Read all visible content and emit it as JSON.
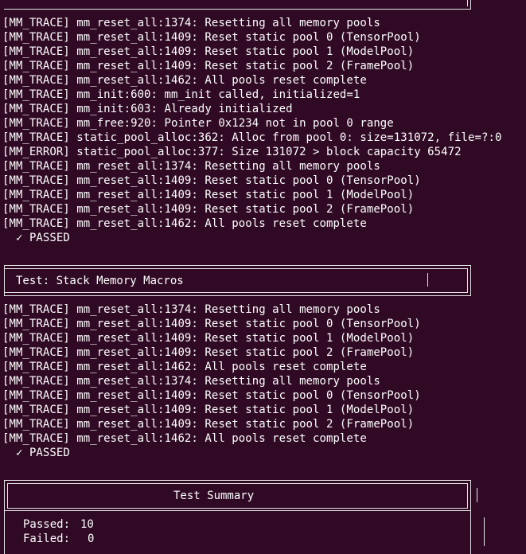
{
  "log_block_1": [
    "[MM_TRACE] mm_reset_all:1374: Resetting all memory pools",
    "[MM_TRACE] mm_reset_all:1409: Reset static pool 0 (TensorPool)",
    "[MM_TRACE] mm_reset_all:1409: Reset static pool 1 (ModelPool)",
    "[MM_TRACE] mm_reset_all:1409: Reset static pool 2 (FramePool)",
    "[MM_TRACE] mm_reset_all:1462: All pools reset complete",
    "[MM_TRACE] mm_init:600: mm_init called, initialized=1",
    "[MM_TRACE] mm_init:603: Already initialized",
    "[MM_TRACE] mm_free:920: Pointer 0x1234 not in pool 0 range",
    "[MM_TRACE] static_pool_alloc:362: Alloc from pool 0: size=131072, file=?:0",
    "[MM_ERROR] static_pool_alloc:377: Size 131072 > block capacity 65472",
    "[MM_TRACE] mm_reset_all:1374: Resetting all memory pools",
    "[MM_TRACE] mm_reset_all:1409: Reset static pool 0 (TensorPool)",
    "[MM_TRACE] mm_reset_all:1409: Reset static pool 1 (ModelPool)",
    "[MM_TRACE] mm_reset_all:1409: Reset static pool 2 (FramePool)",
    "[MM_TRACE] mm_reset_all:1462: All pools reset complete"
  ],
  "passed_1": "✓ PASSED",
  "test_header_title": "Test: Stack Memory Macros",
  "log_block_2": [
    "[MM_TRACE] mm_reset_all:1374: Resetting all memory pools",
    "[MM_TRACE] mm_reset_all:1409: Reset static pool 0 (TensorPool)",
    "[MM_TRACE] mm_reset_all:1409: Reset static pool 1 (ModelPool)",
    "[MM_TRACE] mm_reset_all:1409: Reset static pool 2 (FramePool)",
    "[MM_TRACE] mm_reset_all:1462: All pools reset complete",
    "[MM_TRACE] mm_reset_all:1374: Resetting all memory pools",
    "[MM_TRACE] mm_reset_all:1409: Reset static pool 0 (TensorPool)",
    "[MM_TRACE] mm_reset_all:1409: Reset static pool 1 (ModelPool)",
    "[MM_TRACE] mm_reset_all:1409: Reset static pool 2 (FramePool)",
    "[MM_TRACE] mm_reset_all:1462: All pools reset complete"
  ],
  "passed_2": "✓ PASSED",
  "summary": {
    "title": "Test Summary",
    "passed_label": "Passed:",
    "passed_value": "10",
    "failed_label": "Failed:",
    "failed_value": "0"
  },
  "colors": {
    "background": "#300a24",
    "text": "#ffffff",
    "box_border": "#e8e4e6"
  }
}
